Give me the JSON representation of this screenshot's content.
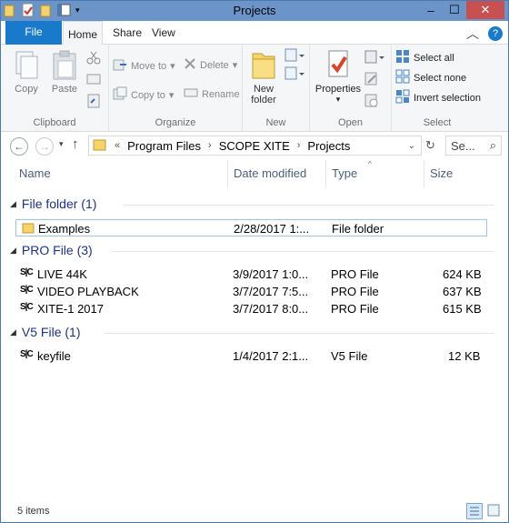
{
  "window": {
    "title": "Projects",
    "controls": {
      "minimize": "–",
      "maximize": "☐",
      "close": "✕"
    }
  },
  "tabs": {
    "file": "File",
    "home": "Home",
    "share": "Share",
    "view": "View"
  },
  "ribbon": {
    "clipboard": {
      "label": "Clipboard",
      "copy": "Copy",
      "paste": "Paste"
    },
    "organize": {
      "label": "Organize",
      "move_to": "Move to",
      "copy_to": "Copy to",
      "delete": "Delete",
      "rename": "Rename"
    },
    "new": {
      "label": "New",
      "new_folder_line1": "New",
      "new_folder_line2": "folder"
    },
    "open": {
      "label": "Open",
      "properties": "Properties"
    },
    "select": {
      "label": "Select",
      "select_all": "Select all",
      "select_none": "Select none",
      "invert_selection": "Invert selection"
    }
  },
  "address": {
    "overflow": "«",
    "crumbs": [
      "Program Files",
      "SCOPE XITE",
      "Projects"
    ],
    "search_placeholder": "Se..."
  },
  "columns": {
    "name": "Name",
    "date": "Date modified",
    "type": "Type",
    "size": "Size"
  },
  "groups": [
    {
      "title": "File folder (1)",
      "rows": [
        {
          "name": "Examples",
          "date": "2/28/2017 1:...",
          "type": "File folder",
          "size": ""
        }
      ]
    },
    {
      "title": "PRO File (3)",
      "rows": [
        {
          "name": "LIVE 44K",
          "date": "3/9/2017 1:0...",
          "type": "PRO File",
          "size": "624 KB"
        },
        {
          "name": "VIDEO PLAYBACK",
          "date": "3/7/2017 7:5...",
          "type": "PRO File",
          "size": "637 KB"
        },
        {
          "name": "XITE-1 2017",
          "date": "3/7/2017 8:0...",
          "type": "PRO File",
          "size": "615 KB"
        }
      ]
    },
    {
      "title": "V5 File (1)",
      "rows": [
        {
          "name": "keyfile",
          "date": "1/4/2017 2:1...",
          "type": "V5 File",
          "size": "12 KB"
        }
      ]
    }
  ],
  "status": {
    "items": "5 items"
  },
  "colors": {
    "titlebar": "#6b95c9",
    "file_tab": "#1979ca",
    "group_text": "#1e3287",
    "close": "#c75050"
  }
}
